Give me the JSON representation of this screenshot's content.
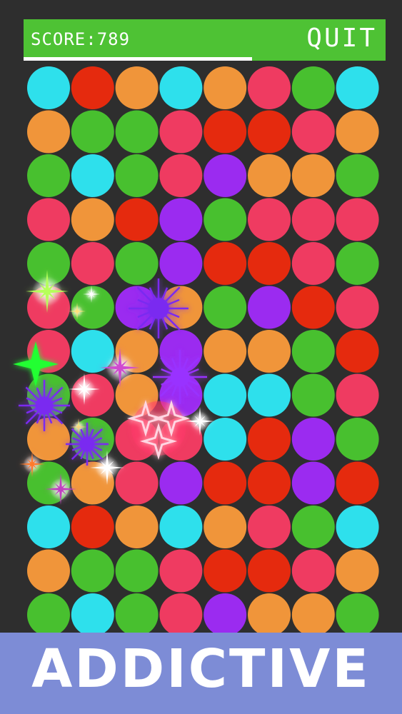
{
  "header": {
    "score_label": "SCORE:789",
    "quit_label": "QUIT"
  },
  "progress": {
    "fraction": 0.63
  },
  "banner": {
    "text": "ADDICTIVE"
  },
  "colors": {
    "c": "#2ee0ec",
    "r": "#e52a0e",
    "o": "#f0953a",
    "p": "#ef3b61",
    "g": "#48c02f",
    "v": "#9b2bf0",
    "bar": "#4ec234",
    "banner": "#7d8cd6",
    "bg": "#2e2e2e"
  },
  "board": {
    "rows": [
      [
        "c",
        "r",
        "o",
        "c",
        "o",
        "p",
        "g",
        "c"
      ],
      [
        "o",
        "g",
        "g",
        "p",
        "r",
        "r",
        "p",
        "o"
      ],
      [
        "g",
        "c",
        "g",
        "p",
        "v",
        "o",
        "o",
        "g"
      ],
      [
        "p",
        "o",
        "r",
        "v",
        "g",
        "p",
        "p",
        "p"
      ],
      [
        "g",
        "p",
        "g",
        "v",
        "r",
        "r",
        "p",
        "g"
      ],
      [
        "p",
        "g",
        "v",
        "o",
        "g",
        "v",
        "r",
        "p"
      ],
      [
        "p",
        "c",
        "o",
        "v",
        "o",
        "o",
        "g",
        "r"
      ],
      [
        "g",
        "p",
        "o",
        "v",
        "c",
        "c",
        "g",
        "p"
      ],
      [
        "o",
        "g",
        "p",
        "p",
        "c",
        "r",
        "v",
        "g"
      ],
      [
        "g",
        "o",
        "p",
        "v",
        "r",
        "r",
        "v",
        "r"
      ],
      [
        "c",
        "r",
        "o",
        "c",
        "o",
        "p",
        "g",
        "c"
      ],
      [
        "o",
        "g",
        "g",
        "p",
        "r",
        "r",
        "p",
        "o"
      ],
      [
        "g",
        "c",
        "g",
        "p",
        "v",
        "o",
        "o",
        "g"
      ]
    ]
  },
  "effects": [
    {
      "type": "sparkle",
      "color": "#b6ff5a",
      "name": "sparkle-icon"
    },
    {
      "type": "sparkle",
      "color": "#ffffff",
      "name": "sparkle-icon"
    },
    {
      "type": "sparkle",
      "color": "#ffe27a",
      "name": "sparkle-icon"
    },
    {
      "type": "burst",
      "color": "#7a2bf0",
      "name": "burst-icon"
    },
    {
      "type": "burst",
      "color": "#9933ff",
      "name": "burst-icon"
    },
    {
      "type": "star4",
      "color": "#22ff33",
      "name": "green-star-icon"
    },
    {
      "type": "sparkle",
      "color": "#ffffff",
      "name": "sparkle-icon"
    },
    {
      "type": "sparkle",
      "color": "#d04ad0",
      "name": "sparkle-icon"
    },
    {
      "type": "burst",
      "color": "#7a2bf0",
      "name": "burst-icon"
    },
    {
      "type": "ring",
      "color": "#ff3a6a",
      "name": "pink-star-ring-icon"
    },
    {
      "type": "sparkle",
      "color": "#ffffff",
      "name": "sparkle-icon"
    },
    {
      "type": "sparkle",
      "color": "#ffe27a",
      "name": "sparkle-icon"
    },
    {
      "type": "sparkle",
      "color": "#ffffff",
      "name": "sparkle-icon"
    },
    {
      "type": "burst",
      "color": "#7a2bf0",
      "name": "burst-icon"
    },
    {
      "type": "sparkle",
      "color": "#c040c0",
      "name": "sparkle-icon"
    },
    {
      "type": "sparkle",
      "color": "#ff7a2a",
      "name": "sparkle-icon"
    }
  ]
}
